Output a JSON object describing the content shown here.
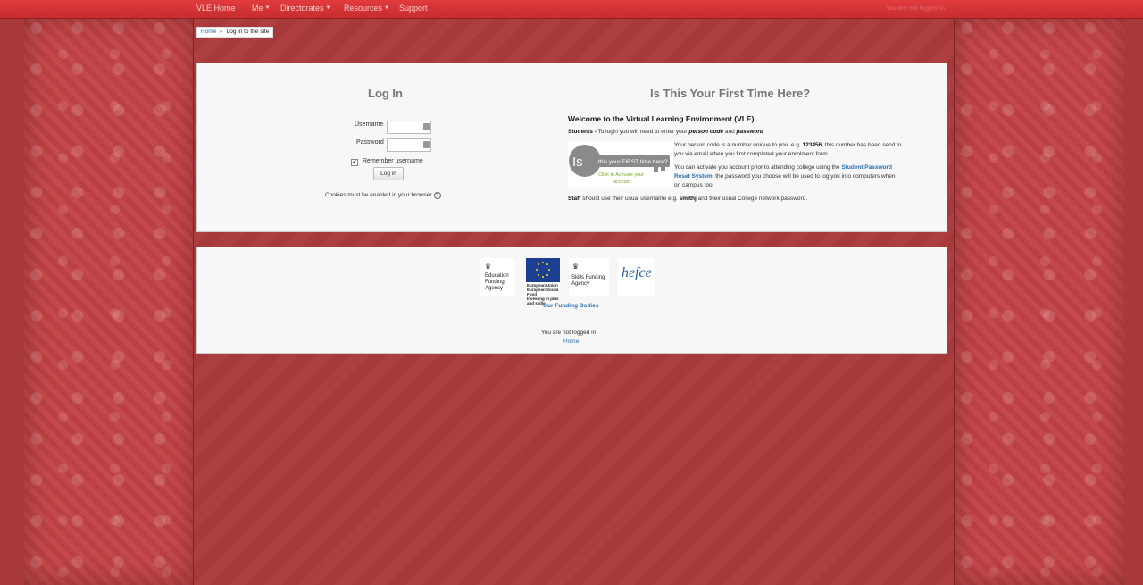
{
  "navbar": {
    "items": [
      {
        "label": "VLE Home",
        "has_caret": false
      },
      {
        "label": "Me",
        "has_caret": true
      },
      {
        "label": "Directorates",
        "has_caret": true
      },
      {
        "label": "Resources",
        "has_caret": true
      },
      {
        "label": "Support",
        "has_caret": false
      }
    ],
    "login_status": "You are not logged in."
  },
  "breadcrumb": {
    "home": "Home",
    "current": "Log in to the site"
  },
  "login": {
    "heading": "Log In",
    "username_label": "Username",
    "password_label": "Password",
    "remember_label": "Remember username",
    "remember_checked": true,
    "button": "Log in",
    "cookies_note": "Cookies must be enabled in your browser"
  },
  "first_time": {
    "heading": "Is This Your First Time Here?",
    "welcome": "Welcome to the Virtual Learning Environment (VLE)",
    "students_bold": "Students -",
    "students_text": "To login you will need to enter your",
    "person_code": "person code",
    "and": "and",
    "password_word": "password",
    "key_text_line1": "this your FIRST time here?",
    "key_text_line2": "Click to Activate your",
    "key_text_line3": "account",
    "key_letters": "Is",
    "para1_a": "Your person code is a number unique to you. e.g.",
    "para1_code": "123456",
    "para1_b": ", this number has been send to you via email when you first completed your enrolment form.",
    "para2_a": "You can activate you account prior to attending college using the",
    "para2_link": "Student Password Reset System",
    "para2_b": ", the password you choose will be used to log you into computers when on campus too.",
    "staff_bold": "Staff",
    "staff_text_a": "should use their usual username e.g.",
    "staff_example": "smithj",
    "staff_text_b": "and their usual College network password."
  },
  "funding": {
    "logos": [
      {
        "name": "Education Funding Agency",
        "lines": [
          "Education",
          "Funding",
          "Agency"
        ]
      },
      {
        "name": "European Union",
        "lines": [
          "European Union",
          "European Social Fund",
          "Investing in jobs and skills"
        ]
      },
      {
        "name": "Skills Funding Agency",
        "lines": [
          "Skills Funding",
          "Agency"
        ]
      },
      {
        "name": "hefce",
        "lines": [
          "hefce"
        ]
      }
    ],
    "link": "Our Funding Bodies",
    "not_logged_in": "You are not logged in",
    "home": "Home"
  },
  "colors": {
    "navbar": "#d93538",
    "background": "#ab3a3c",
    "link": "#2a6fb0"
  }
}
